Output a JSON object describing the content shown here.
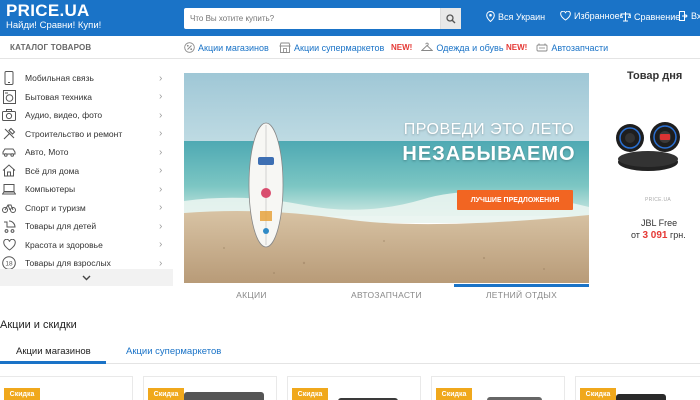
{
  "header": {
    "logo_title": "PRICE.UA",
    "logo_subtitle": "Найди! Сравни! Купи!",
    "search_placeholder": "Что Вы хотите купить?",
    "region": "Вся Украин",
    "favorites": "Избранное",
    "compare": "Сравнение",
    "login": "Вхо"
  },
  "subnav": {
    "catalog": "КАТАЛОГ ТОВАРОВ",
    "links": [
      {
        "label": "Акции магазинов",
        "new": false
      },
      {
        "label": "Акции супермаркетов",
        "new": false
      },
      {
        "label": "Одежда и обувь",
        "new": true
      },
      {
        "label": "Автозапчасти",
        "new": true
      }
    ],
    "new_label": "NEW!"
  },
  "sidebar": {
    "items": [
      {
        "label": "Мобильная связь",
        "icon": "phone-icon"
      },
      {
        "label": "Бытовая техника",
        "icon": "washer-icon"
      },
      {
        "label": "Аудио, видео, фото",
        "icon": "camera-icon"
      },
      {
        "label": "Строительство и ремонт",
        "icon": "tools-icon"
      },
      {
        "label": "Авто, Мото",
        "icon": "car-icon"
      },
      {
        "label": "Всё для дома",
        "icon": "home-icon"
      },
      {
        "label": "Компьютеры",
        "icon": "laptop-icon"
      },
      {
        "label": "Спорт и туризм",
        "icon": "bike-icon"
      },
      {
        "label": "Товары для детей",
        "icon": "stroller-icon"
      },
      {
        "label": "Красота и здоровье",
        "icon": "heart-icon"
      },
      {
        "label": "Товары для взрослых",
        "icon": "adult-18-icon"
      }
    ],
    "adult_badge": "18"
  },
  "banner": {
    "line1": "ПРОВЕДИ ЭТО ЛЕТО",
    "line2": "НЕЗАБЫВАЕМО",
    "button": "ЛУЧШИЕ ПРЕДЛОЖЕНИЯ",
    "tabs": [
      "АКЦИИ",
      "АВТОЗАПЧАСТИ",
      "ЛЕТНИЙ ОТДЫХ"
    ],
    "active_tab": 2
  },
  "product_of_day": {
    "title": "Товар дня",
    "site_mark": "PRICE.UA",
    "name": "JBL Free",
    "price_prefix": "от",
    "price": "3 091",
    "currency": "грн."
  },
  "deals": {
    "title": "Акции и скидки",
    "tabs": [
      "Акции магазинов",
      "Акции супермаркетов"
    ],
    "badge": "Скидка"
  },
  "colors": {
    "brand_blue": "#1a73c7",
    "accent_orange": "#f26522",
    "new_red": "#e53935",
    "sale_yellow": "#f0a81c"
  }
}
